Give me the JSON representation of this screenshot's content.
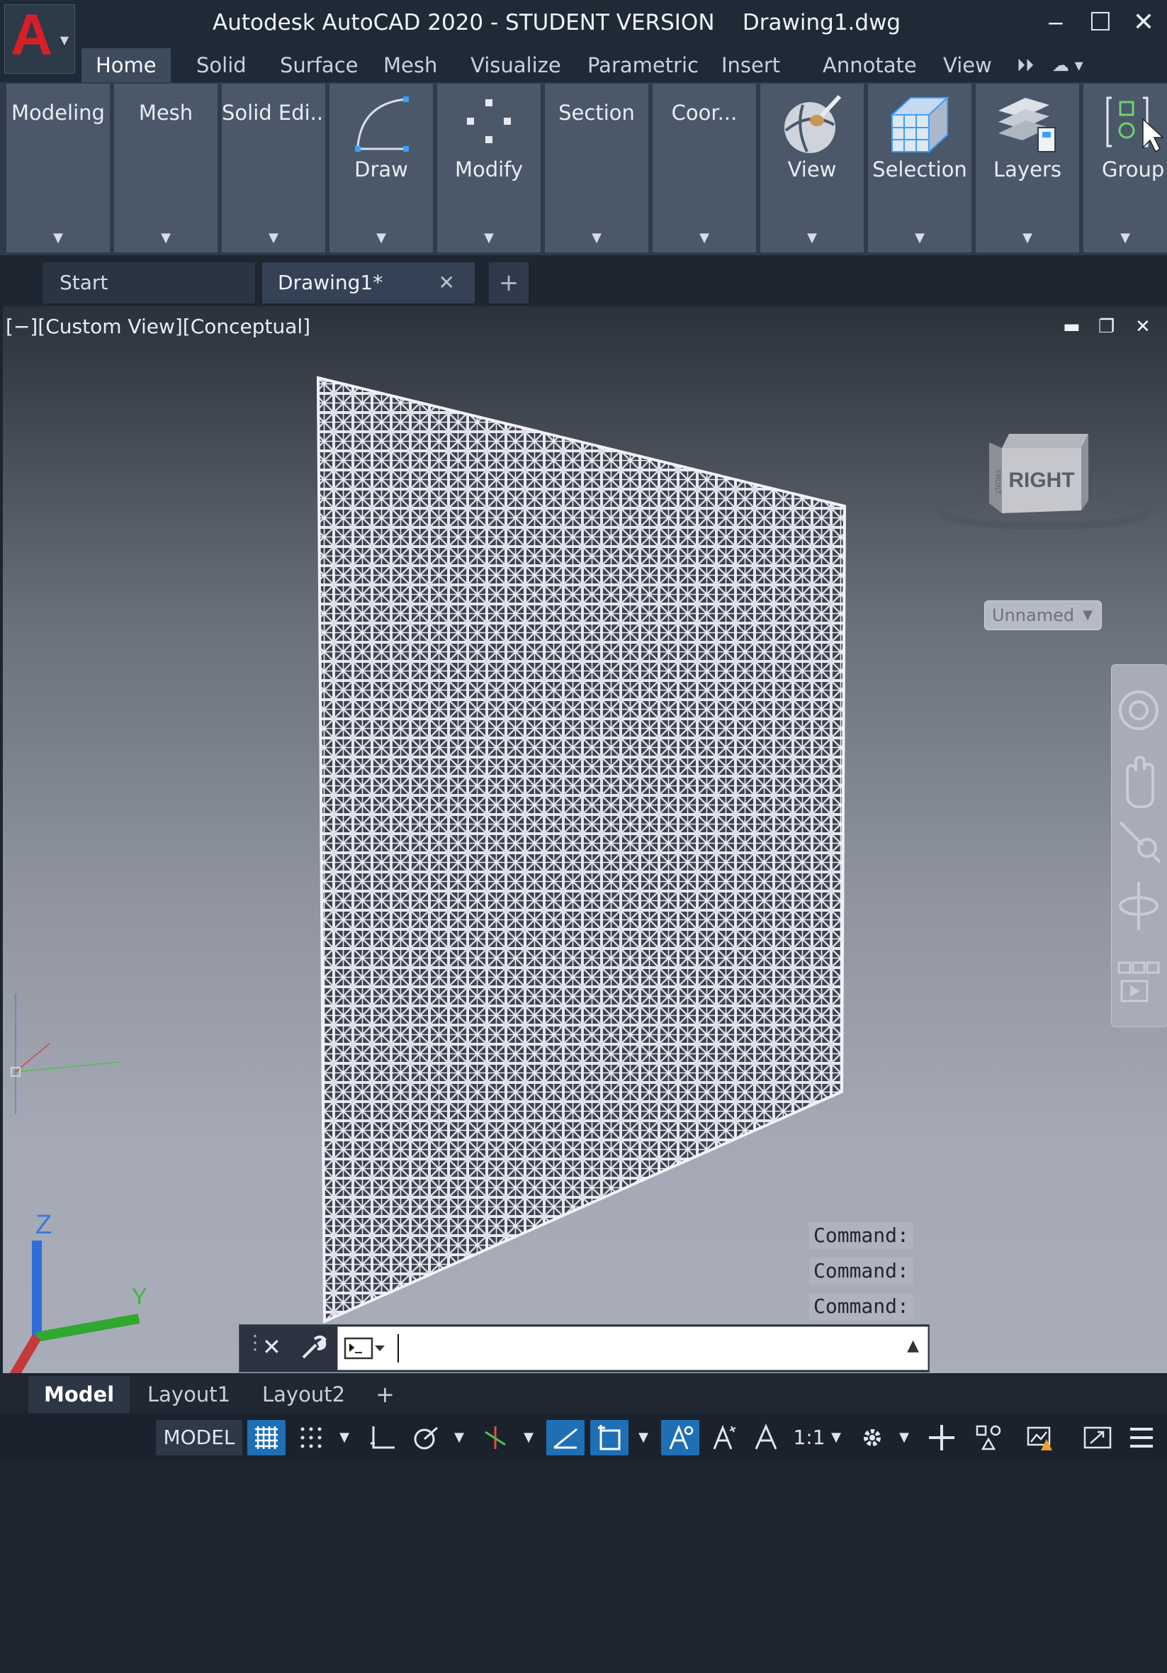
{
  "app": {
    "logo_letter": "A",
    "title": "Autodesk AutoCAD 2020 - STUDENT VERSION    Drawing1.dwg"
  },
  "window_controls": {
    "minimize": "‒",
    "maximize": "☐",
    "close": "✕"
  },
  "ribbon_tabs": [
    "Home",
    "Solid",
    "Surface",
    "Mesh",
    "Visualize",
    "Parametric",
    "Insert",
    "Annotate",
    "View"
  ],
  "ribbon_panels": [
    "Modeling",
    "Mesh",
    "Solid Edi...",
    "Draw",
    "Modify",
    "Section",
    "Coor...",
    "View",
    "Selection",
    "Layers",
    "Group"
  ],
  "doc_tabs": {
    "start": "Start",
    "drawing": "Drawing1*",
    "close": "✕",
    "add": "+"
  },
  "viewport": {
    "label": "[−][Custom View][Conceptual]",
    "controls": {
      "minimize": "▬",
      "restore": "❐",
      "close": "✕"
    },
    "viewcube_face": "RIGHT",
    "viewcube_side": "FRONT",
    "ucs_name": "Unnamed",
    "axis_labels": {
      "z": "Z",
      "y": "Y"
    }
  },
  "command_history": [
    "Command:",
    "Command:",
    "Command:"
  ],
  "command_line": {
    "value": "",
    "close": "✕"
  },
  "layout_tabs": [
    "Model",
    "Layout1",
    "Layout2"
  ],
  "layout_add": "+",
  "status_bar": {
    "model": "MODEL",
    "scale": "1:1"
  },
  "colors": {
    "accent": "#1f6fb5",
    "logo": "#d62027",
    "ribbon_panel": "#4a586a",
    "titlebar": "#1f2a37"
  }
}
